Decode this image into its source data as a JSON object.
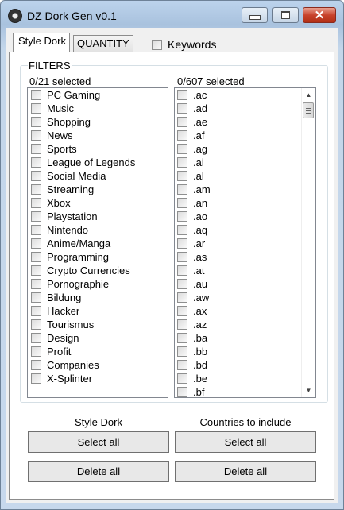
{
  "window": {
    "title": "DZ Dork Gen v0.1",
    "controls": {
      "minimize_icon": "minimize-icon",
      "maximize_icon": "maximize-icon",
      "close_icon": "close-icon",
      "close_glyph": "✕"
    }
  },
  "tabs": [
    {
      "label": "Style Dork",
      "active": true
    },
    {
      "label": "QUANTITY",
      "active": false
    }
  ],
  "keywords": {
    "label": "Keywords",
    "checked": false
  },
  "filters": {
    "title": "FILTERS",
    "styles": {
      "count_label": "0/21 selected",
      "items": [
        "PC Gaming",
        "Music",
        "Shopping",
        "News",
        "Sports",
        "League of Legends",
        "Social Media",
        "Streaming",
        "Xbox",
        "Playstation",
        "Nintendo",
        "Anime/Manga",
        "Programming",
        "Crypto Currencies",
        "Pornographie",
        "Bildung",
        "Hacker",
        "Tourismus",
        "Design",
        "Profit",
        "Companies",
        "X-Splinter"
      ]
    },
    "countries": {
      "count_label": "0/607 selected",
      "items": [
        ".ac",
        ".ad",
        ".ae",
        ".af",
        ".ag",
        ".ai",
        ".al",
        ".am",
        ".an",
        ".ao",
        ".aq",
        ".ar",
        ".as",
        ".at",
        ".au",
        ".aw",
        ".ax",
        ".az",
        ".ba",
        ".bb",
        ".bd",
        ".be",
        ".bf"
      ],
      "scroll": {
        "up_glyph": "▲",
        "down_glyph": "▼",
        "position": 0
      }
    }
  },
  "actions": {
    "style_caption": "Style Dork",
    "countries_caption": "Countries to include",
    "style_select_all": "Select all",
    "style_delete_all": "Delete all",
    "countries_select_all": "Select all",
    "countries_delete_all": "Delete all"
  },
  "colors": {
    "close_button": "#c8432c",
    "titlebar": "#bcd3ec"
  }
}
